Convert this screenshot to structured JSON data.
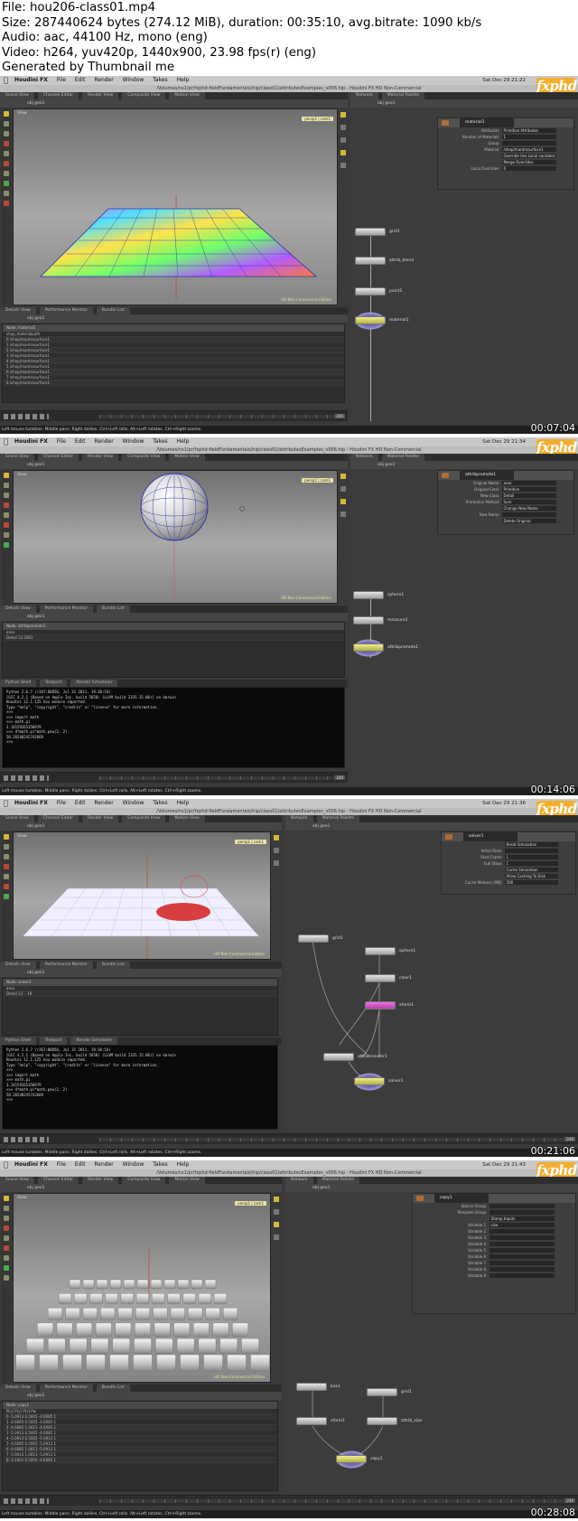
{
  "info": {
    "lines": [
      "File: hou206-class01.mp4",
      "Size: 287440624 bytes (274.12 MiB), duration: 00:35:10, avg.bitrate: 1090 kb/s",
      "Audio: aac, 44100 Hz, mono (eng)",
      "Video: h264, yuv420p, 1440x900, 23.98 fps(r) (eng)",
      "Generated by Thumbnail me"
    ]
  },
  "common": {
    "apple": "",
    "menus": [
      "Houdini FX",
      "File",
      "Edit",
      "Render",
      "Window",
      "Takes",
      "Help"
    ],
    "logo": "fxphd",
    "view_label": "View",
    "camera_label": "persp1 | cam1",
    "edition": "HD Non-Commercial Edition",
    "pane_tabs": [
      "Scene View",
      "Channel Editor",
      "Render View",
      "Composite View",
      "Motion View"
    ],
    "lower_tabs": [
      "Details View",
      "Performance Monitor",
      "Bundle List"
    ],
    "network_tabs": [
      "Network",
      "Material Palette"
    ],
    "shell_tabs": [
      "Python Shell",
      "Textport",
      "Render Scheduler"
    ],
    "path": "obj  geo1",
    "status": "Left mouse tumbles. Middle pans. Right dollies. Ctrl+Left rolls. Alt+Left rotates. Ctrl+Right zooms."
  },
  "frames": [
    {
      "timestamp": "00:07:04",
      "title": "/Volumes/ns1/pr/fxphd-fieldFundamentals/hip/class01/attributesExamples_v006.hip - Houdini FX HD Non-Commercial",
      "clock": "Sat Dec 29 21:22",
      "params": {
        "node_name": "material1",
        "rows": [
          {
            "label": "Attributes",
            "value": "Primitive Attributes"
          },
          {
            "label": "Number of Materials",
            "value": "1"
          },
          {
            "label": "Group",
            "value": ""
          },
          {
            "label": "Material",
            "value": "/shop/mantrasurface1"
          },
          {
            "label": "",
            "value": "Override Use Local variables"
          },
          {
            "label": "",
            "value": "Merge Overrides"
          },
          {
            "label": "Local Overrides",
            "value": "0"
          }
        ]
      },
      "nodes": [
        "grid1",
        "attrib_blend",
        "point1",
        "material1"
      ],
      "spreadsheet": {
        "head": "Node: material1",
        "rows": [
          "shop_materialpath",
          "0  /shop/mantrasurface1",
          "1  /shop/mantrasurface1",
          "2  /shop/mantrasurface1",
          "3  /shop/mantrasurface1",
          "4  /shop/mantrasurface1",
          "5  /shop/mantrasurface1",
          "6  /shop/mantrasurface1",
          "7  /shop/mantrasurface1",
          "8  /shop/mantrasurface1"
        ]
      },
      "frame_field": "25",
      "end_frame": "240"
    },
    {
      "timestamp": "00:14:06",
      "title": "/Volumes/ns1/pr/fxphd-fieldFundamentals/hip/class01/attributesExamples_v006.hip - Houdini FX HD Non-Commercial",
      "clock": "Sat Dec 29 21:34",
      "params": {
        "node_name": "attribpromote1",
        "rows": [
          {
            "label": "Original Name",
            "value": "area"
          },
          {
            "label": "Original Class",
            "value": "Primitive"
          },
          {
            "label": "New Class",
            "value": "Detail"
          },
          {
            "label": "Promotion Method",
            "value": "Sum"
          },
          {
            "label": "",
            "value": "Change New Name"
          },
          {
            "label": "New Name",
            "value": ""
          },
          {
            "label": "",
            "value": "Delete Original"
          }
        ]
      },
      "nodes": [
        "sphere1",
        "measure1",
        "attribpromote1"
      ],
      "spreadsheet": {
        "head": "Node: attribpromote1",
        "rows": [
          "area",
          "Detail  12.2661"
        ]
      },
      "shell": [
        "Python 2.6.7 (r267:88850, Jul 31 2011, 19:30:54)",
        "[GCC 4.2.1 (Based on Apple Inc. build 5658) (LLVM build 2335.15.00)] on darwin",
        "Houdini 12.1.125 hou module imported.",
        "Type \"help\", \"copyright\", \"credits\" or \"license\" for more information.",
        ">>>",
        ">>> import math",
        ">>> math.pi",
        "3.14159265358979",
        ">>> 4*math.pi*math.pow(2, 2)",
        "50.26548245743669",
        ">>>"
      ],
      "frame_field": "25",
      "end_frame": "240"
    },
    {
      "timestamp": "00:21:06",
      "title": "/Volumes/ns1/pr/fxphd-fieldFundamentals/hip/class01/attributesExamples_v006.hip - Houdini FX HD Non-Commercial",
      "clock": "Sat Dec 29 21:36",
      "params": {
        "node_name": "solver1",
        "rows": [
          {
            "label": "",
            "value": "Reset Simulation"
          },
          {
            "label": "Initial State",
            "value": ""
          },
          {
            "label": "Start Frame",
            "value": "1"
          },
          {
            "label": "Sub Steps",
            "value": "1"
          },
          {
            "label": "",
            "value": "Cache Simulation"
          },
          {
            "label": "",
            "value": "Allow Caching To Disk"
          },
          {
            "label": "Cache Memory (MB)",
            "value": "500"
          }
        ]
      },
      "nodes": [
        "grid1",
        "sphere1",
        "color1",
        "xform1",
        "attribtransfer1",
        "solver1"
      ],
      "spreadsheet": {
        "head": "Node: solver1",
        "rows": [
          "area",
          "Detail  13 .. 19"
        ]
      },
      "shell": [
        "Python 2.6.7 (r267:88850, Jul 31 2011, 19:30:54)",
        "[GCC 4.2.1 (Based on Apple Inc. build 5658) (LLVM build 2335.15.00)] on darwin",
        "Houdini 12.1.125 hou module imported.",
        "Type \"help\", \"copyright\", \"credits\" or \"license\" for more information.",
        ">>>",
        ">>> import math",
        ">>> math.pi",
        "3.14159265358979",
        ">>> 4*math.pi*math.pow(2, 2)",
        "50.26548245743669",
        ">>>"
      ],
      "frame_field": "1",
      "end_frame": "240"
    },
    {
      "timestamp": "00:28:08",
      "title": "/Volumes/ns1/pr/fxphd-fieldFundamentals/hip/class01/attributesExamples_v006.hip - Houdini FX HD Non-Commercial",
      "clock": "Sat Dec 29 21:43",
      "params": {
        "node_name": "copy1",
        "rows": [
          {
            "label": "Source Group",
            "value": ""
          },
          {
            "label": "Template Group",
            "value": ""
          },
          {
            "label": "",
            "value": "Stamp Inputs"
          },
          {
            "label": "Variable 1",
            "value": "size"
          },
          {
            "label": "Variable 2",
            "value": ""
          },
          {
            "label": "Variable 3",
            "value": ""
          },
          {
            "label": "Variable 4",
            "value": ""
          },
          {
            "label": "Variable 5",
            "value": ""
          },
          {
            "label": "Variable 6",
            "value": ""
          },
          {
            "label": "Variable 7",
            "value": ""
          },
          {
            "label": "Variable 8",
            "value": ""
          },
          {
            "label": "Variable 9",
            "value": ""
          }
        ]
      },
      "nodes": [
        "box1",
        "grid1",
        "xform1",
        "attrib_size",
        "copy1"
      ],
      "spreadsheet": {
        "head": "Node: copy1",
        "rows": [
          "P[x]  P[y]  P[z]  Pw",
          "0  -5.0913  0.5005  -4.6085  1",
          "1  -4.6085  0.5005  -4.6085  1",
          "2  -4.6085  1.0013  -4.6085  1",
          "3  -5.0913  0.5005  -4.6085  1",
          "4  -5.0913  0.5005  -5.0913  1",
          "5  -4.6085  0.5005  -5.0913  1",
          "6  -4.6085  1.0013  -5.0913  1",
          "7  -5.0913  1.0013  -5.0913  1",
          "8  -3.1001  0.5005  -4.6085  1"
        ]
      },
      "frame_field": "1",
      "end_frame": "240"
    }
  ]
}
